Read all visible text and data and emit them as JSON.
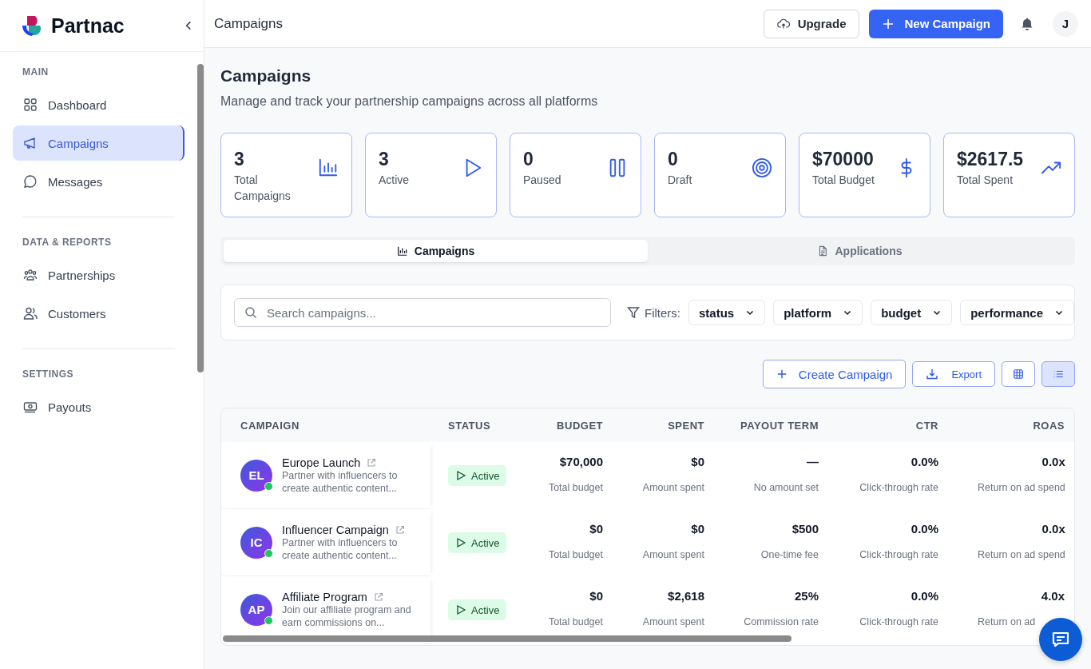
{
  "brand": {
    "name": "Partnac"
  },
  "sidebar": {
    "sections": [
      {
        "title": "MAIN",
        "items": [
          {
            "label": "Dashboard",
            "selected": false
          },
          {
            "label": "Campaigns",
            "selected": true
          },
          {
            "label": "Messages",
            "selected": false
          }
        ]
      },
      {
        "title": "DATA & REPORTS",
        "items": [
          {
            "label": "Partnerships",
            "selected": false
          },
          {
            "label": "Customers",
            "selected": false
          }
        ]
      },
      {
        "title": "SETTINGS",
        "items": [
          {
            "label": "Payouts",
            "selected": false
          }
        ]
      }
    ]
  },
  "header": {
    "title": "Campaigns",
    "upgrade": "Upgrade",
    "new_campaign": "New Campaign",
    "avatar": "J"
  },
  "page": {
    "title": "Campaigns",
    "subtitle": "Manage and track your partnership campaigns across all platforms"
  },
  "stats": [
    {
      "value": "3",
      "label": "Total Campaigns"
    },
    {
      "value": "3",
      "label": "Active"
    },
    {
      "value": "0",
      "label": "Paused"
    },
    {
      "value": "0",
      "label": "Draft"
    },
    {
      "value": "$70000",
      "label": "Total Budget"
    },
    {
      "value": "$2617.5",
      "label": "Total Spent"
    }
  ],
  "tabs": [
    {
      "label": "Campaigns",
      "selected": true
    },
    {
      "label": "Applications",
      "selected": false
    }
  ],
  "filters": {
    "search_placeholder": "Search campaigns...",
    "label": "Filters:",
    "dropdowns": [
      "status",
      "platform",
      "budget",
      "performance"
    ]
  },
  "actions": {
    "create": "Create Campaign",
    "export": "Export",
    "views": [
      {
        "selected": false
      },
      {
        "selected": true
      }
    ]
  },
  "table": {
    "columns": [
      "CAMPAIGN",
      "STATUS",
      "BUDGET",
      "SPENT",
      "PAYOUT TERM",
      "CTR",
      "ROAS"
    ],
    "rows": [
      {
        "initials": "EL",
        "name": "Europe Launch",
        "description": "Partner with influencers to create authentic content...",
        "status": "Active",
        "budget": "$70,000",
        "budget_note": "Total budget",
        "spent": "$0",
        "spent_note": "Amount spent",
        "payout": "—",
        "payout_note": "No amount set",
        "ctr": "0.0%",
        "ctr_note": "Click-through rate",
        "roas": "0.0x",
        "roas_note": "Return on ad spend"
      },
      {
        "initials": "IC",
        "name": "Influencer Campaign",
        "description": "Partner with influencers to create authentic content...",
        "status": "Active",
        "budget": "$0",
        "budget_note": "Total budget",
        "spent": "$0",
        "spent_note": "Amount spent",
        "payout": "$500",
        "payout_note": "One-time fee",
        "ctr": "0.0%",
        "ctr_note": "Click-through rate",
        "roas": "0.0x",
        "roas_note": "Return on ad spend"
      },
      {
        "initials": "AP",
        "name": "Affiliate Program",
        "description": "Join our affiliate program and earn commissions on...",
        "status": "Active",
        "budget": "$0",
        "budget_note": "Total budget",
        "spent": "$2,618",
        "spent_note": "Amount spent",
        "payout": "25%",
        "payout_note": "Commission rate",
        "ctr": "0.0%",
        "ctr_note": "Click-through rate",
        "roas": "4.0x",
        "roas_note": "Return on ad"
      }
    ]
  }
}
